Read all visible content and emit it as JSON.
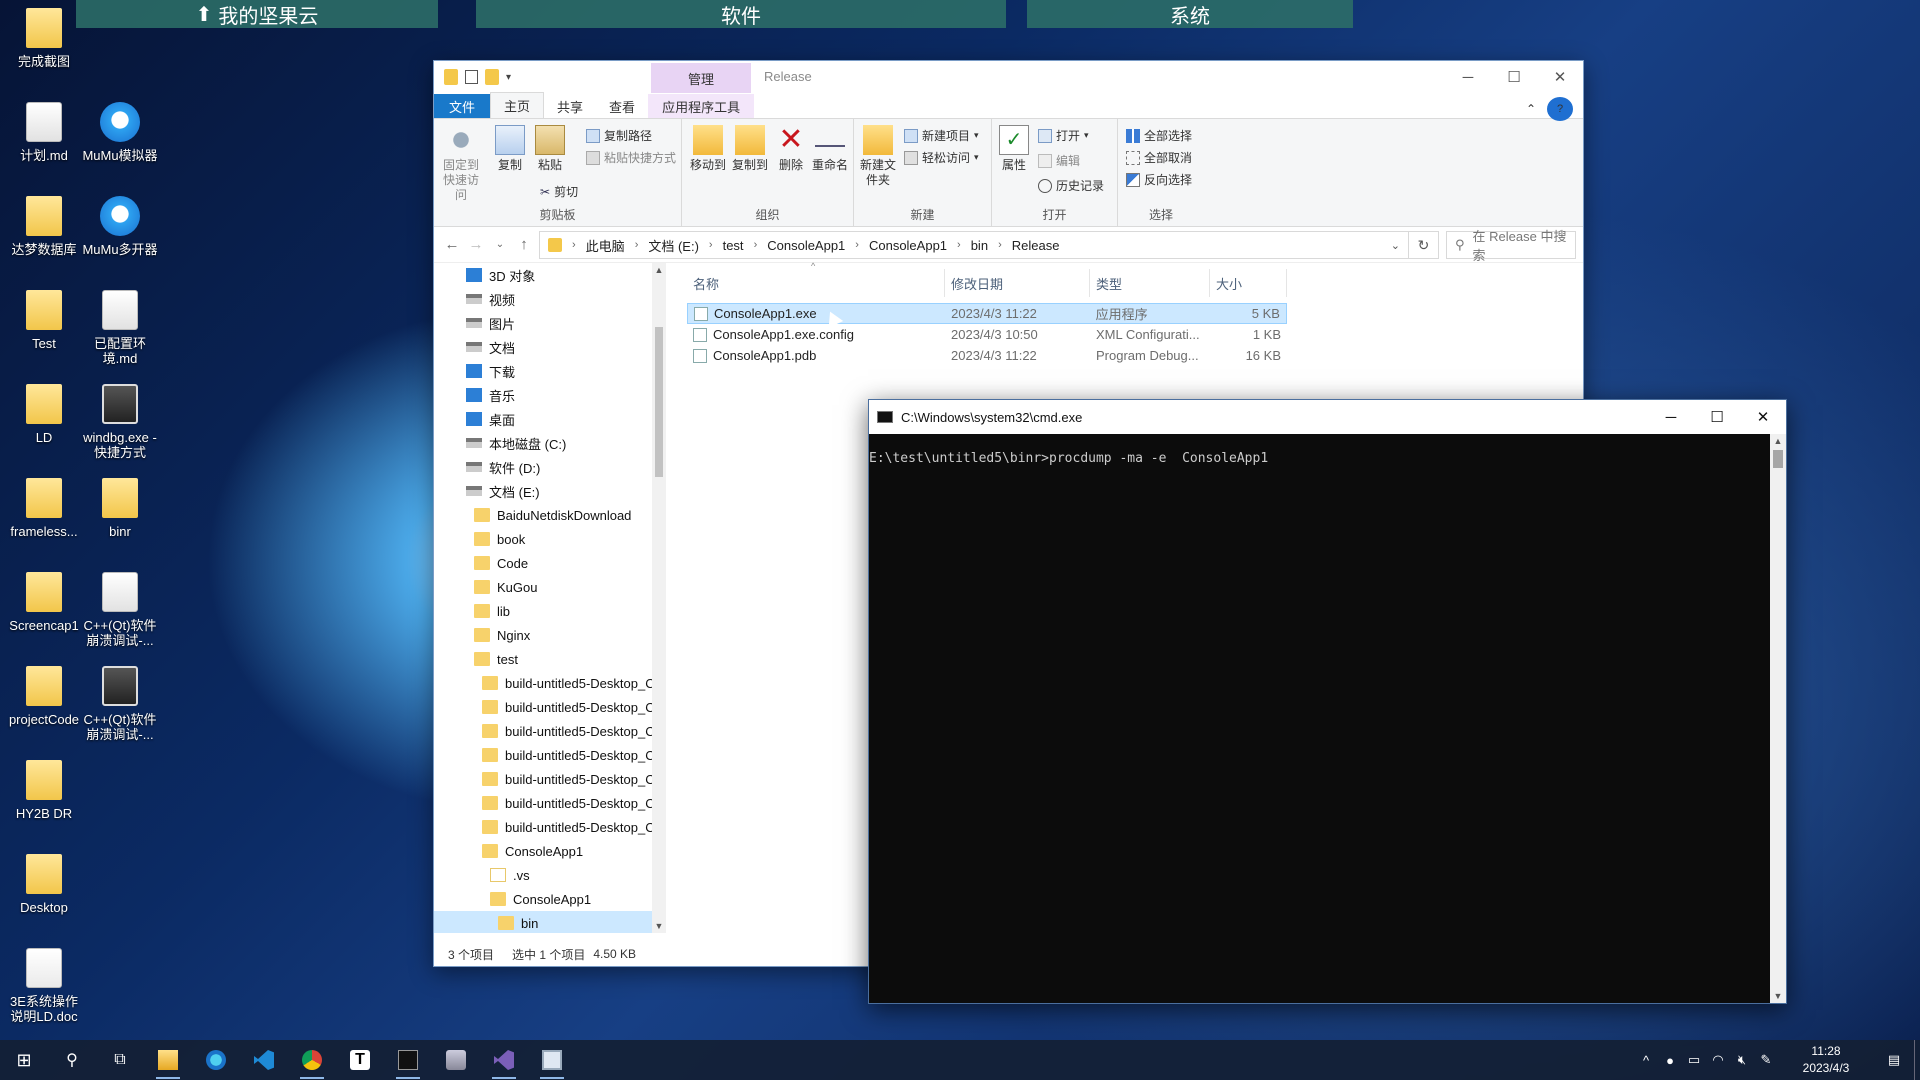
{
  "fences": {
    "cloud": "我的坚果云",
    "software": "软件",
    "system": "系统"
  },
  "desktop_icons": [
    {
      "label": "完成截图",
      "kind": "folder"
    },
    {
      "label": "计划.md",
      "kind": "doc"
    },
    {
      "label": "MuMu模拟器",
      "kind": "app"
    },
    {
      "label": "达梦数据库",
      "kind": "folder"
    },
    {
      "label": "MuMu多开器",
      "kind": "app"
    },
    {
      "label": "Test",
      "kind": "folder"
    },
    {
      "label": "已配置环境.md",
      "kind": "doc"
    },
    {
      "label": "LD",
      "kind": "folder"
    },
    {
      "label": "windbg.exe - 快捷方式",
      "kind": "exe"
    },
    {
      "label": "frameless...",
      "kind": "folder"
    },
    {
      "label": "binr",
      "kind": "folder"
    },
    {
      "label": "Screencap1",
      "kind": "folder"
    },
    {
      "label": "C++(Qt)软件崩溃调试-...",
      "kind": "doc"
    },
    {
      "label": "projectCode",
      "kind": "folder"
    },
    {
      "label": "C++(Qt)软件崩溃调试-...",
      "kind": "exe"
    },
    {
      "label": "HY2B DR",
      "kind": "folder"
    },
    {
      "label": "Desktop",
      "kind": "folder"
    },
    {
      "label": "3E系统操作说明LD.doc",
      "kind": "worddoc"
    }
  ],
  "explorer": {
    "manage_tab": "管理",
    "title": "Release",
    "tabs": [
      "文件",
      "主页",
      "共享",
      "查看",
      "应用程序工具"
    ],
    "ribbon": {
      "clipboard": {
        "pin": "固定到快速访问",
        "copy": "复制",
        "paste": "粘贴",
        "copy_path": "复制路径",
        "paste_shortcut": "粘贴快捷方式",
        "cut": "剪切",
        "group": "剪贴板"
      },
      "organize": {
        "move": "移动到",
        "copyto": "复制到",
        "delete": "删除",
        "rename": "重命名",
        "group": "组织"
      },
      "new": {
        "folder": "新建文件夹",
        "item": "新建项目",
        "easy": "轻松访问",
        "group": "新建"
      },
      "open": {
        "props": "属性",
        "open": "打开",
        "edit": "编辑",
        "history": "历史记录",
        "group": "打开"
      },
      "select": {
        "all": "全部选择",
        "none": "全部取消",
        "invert": "反向选择",
        "group": "选择"
      }
    },
    "breadcrumb": [
      "此电脑",
      "文档 (E:)",
      "test",
      "ConsoleApp1",
      "ConsoleApp1",
      "bin",
      "Release"
    ],
    "search_placeholder": "在 Release 中搜索",
    "nav": [
      {
        "label": "3D 对象",
        "indent": 0,
        "icon": "blue"
      },
      {
        "label": "视频",
        "indent": 0,
        "icon": "drv"
      },
      {
        "label": "图片",
        "indent": 0,
        "icon": "drv"
      },
      {
        "label": "文档",
        "indent": 0,
        "icon": "drv"
      },
      {
        "label": "下载",
        "indent": 0,
        "icon": "blue"
      },
      {
        "label": "音乐",
        "indent": 0,
        "icon": "blue"
      },
      {
        "label": "桌面",
        "indent": 0,
        "icon": "blue"
      },
      {
        "label": "本地磁盘 (C:)",
        "indent": 0,
        "icon": "drv"
      },
      {
        "label": "软件 (D:)",
        "indent": 0,
        "icon": "drv"
      },
      {
        "label": "文档 (E:)",
        "indent": 0,
        "icon": "drv"
      },
      {
        "label": "BaiduNetdiskDownload",
        "indent": 1,
        "icon": "fold"
      },
      {
        "label": "book",
        "indent": 1,
        "icon": "fold"
      },
      {
        "label": "Code",
        "indent": 1,
        "icon": "fold"
      },
      {
        "label": "KuGou",
        "indent": 1,
        "icon": "fold"
      },
      {
        "label": "lib",
        "indent": 1,
        "icon": "fold"
      },
      {
        "label": "Nginx",
        "indent": 1,
        "icon": "fold"
      },
      {
        "label": "test",
        "indent": 1,
        "icon": "fold"
      },
      {
        "label": "build-untitled5-Desktop_C",
        "indent": 2,
        "icon": "fold"
      },
      {
        "label": "build-untitled5-Desktop_C",
        "indent": 2,
        "icon": "fold"
      },
      {
        "label": "build-untitled5-Desktop_C",
        "indent": 2,
        "icon": "fold"
      },
      {
        "label": "build-untitled5-Desktop_C",
        "indent": 2,
        "icon": "fold"
      },
      {
        "label": "build-untitled5-Desktop_C",
        "indent": 2,
        "icon": "fold"
      },
      {
        "label": "build-untitled5-Desktop_C",
        "indent": 2,
        "icon": "fold"
      },
      {
        "label": "build-untitled5-Desktop_C",
        "indent": 2,
        "icon": "fold"
      },
      {
        "label": "ConsoleApp1",
        "indent": 2,
        "icon": "fold"
      },
      {
        "label": ".vs",
        "indent": 3,
        "icon": "folde"
      },
      {
        "label": "ConsoleApp1",
        "indent": 3,
        "icon": "fold"
      },
      {
        "label": "bin",
        "indent": 4,
        "icon": "fold",
        "selected": true
      }
    ],
    "columns": [
      "名称",
      "修改日期",
      "类型",
      "大小"
    ],
    "files": [
      {
        "name": "ConsoleApp1.exe",
        "date": "2023/4/3 11:22",
        "type": "应用程序",
        "size": "5 KB",
        "selected": true
      },
      {
        "name": "ConsoleApp1.exe.config",
        "date": "2023/4/3 10:50",
        "type": "XML Configurati...",
        "size": "1 KB"
      },
      {
        "name": "ConsoleApp1.pdb",
        "date": "2023/4/3 11:22",
        "type": "Program Debug...",
        "size": "16 KB"
      }
    ],
    "status": {
      "count": "3 个项目",
      "selected": "选中 1 个项目",
      "size": "4.50 KB"
    }
  },
  "cmd": {
    "title": "C:\\Windows\\system32\\cmd.exe",
    "line": "E:\\test\\untitled5\\binr>procdump -ma -e  ConsoleApp1"
  },
  "taskbar": {
    "time": "11:28",
    "date": "2023/4/3"
  }
}
